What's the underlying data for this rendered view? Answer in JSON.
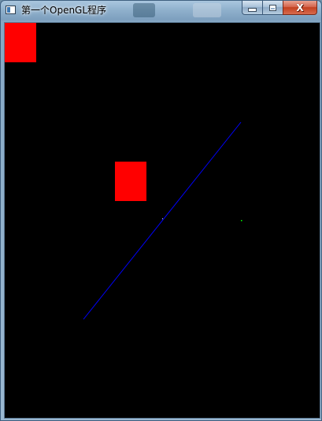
{
  "window": {
    "title": "第一个OpenGL程序",
    "caption_buttons": {
      "minimize": "minimize",
      "maximize": "maximize",
      "close": "close"
    },
    "close_glyph": "X"
  },
  "scene": {
    "background_color": "#000000",
    "rect_color": "#ff0000",
    "line_color": "#0000ff",
    "point_color": "#00ff00"
  }
}
